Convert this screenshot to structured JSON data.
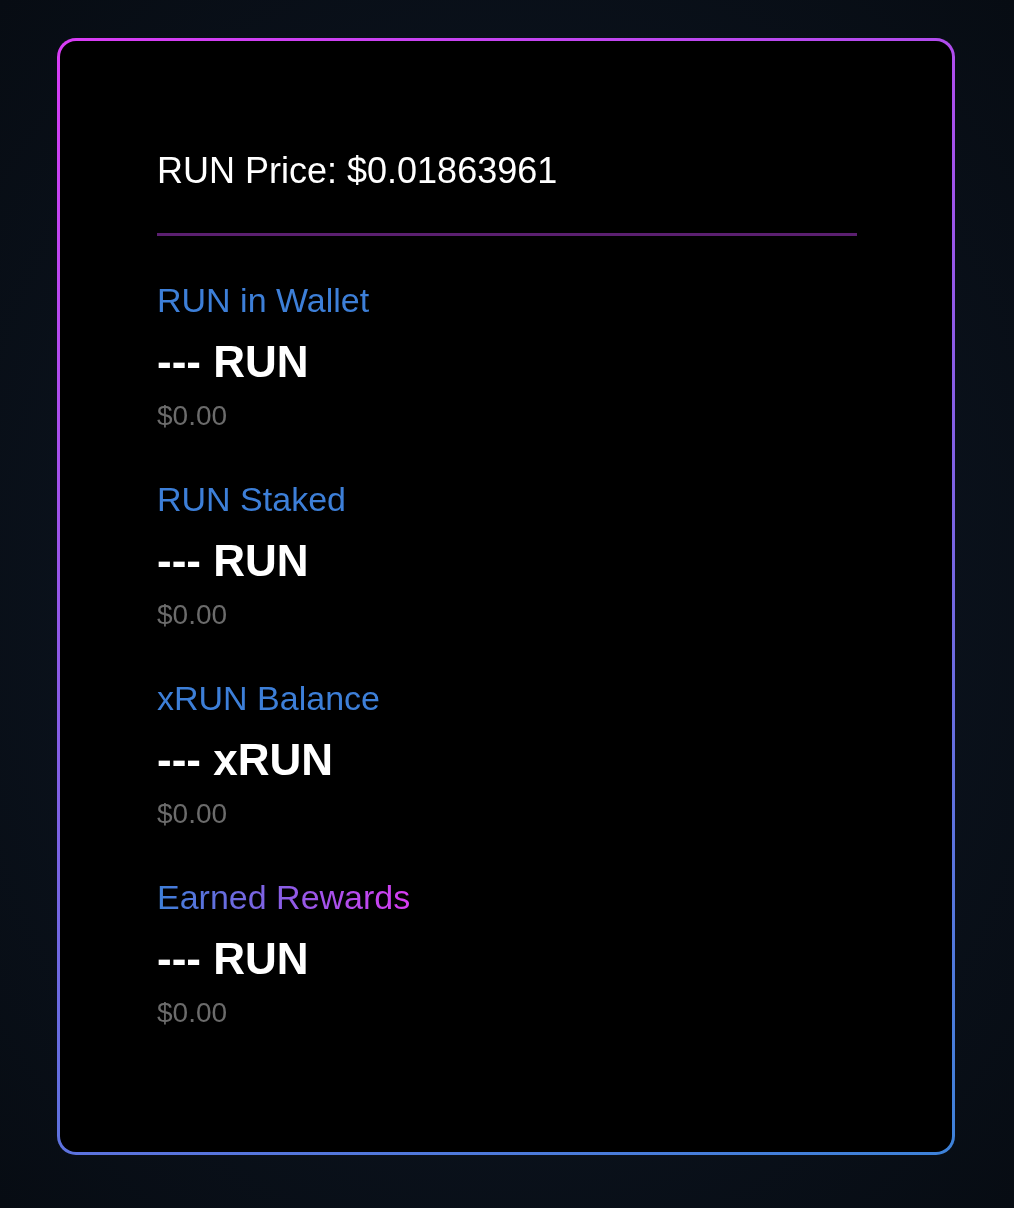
{
  "card": {
    "price": "RUN Price: $0.01863961",
    "stats": [
      {
        "label": "RUN in Wallet",
        "kind": "plain",
        "value": "--- RUN",
        "usd": "$0.00"
      },
      {
        "label": "RUN Staked",
        "kind": "plain",
        "value": "--- RUN",
        "usd": "$0.00"
      },
      {
        "label": "xRUN Balance",
        "kind": "plain",
        "value": "--- xRUN",
        "usd": "$0.00"
      },
      {
        "label": "Earned Rewards",
        "kind": "gradient",
        "value": "--- RUN",
        "usd": "$0.00"
      }
    ]
  }
}
